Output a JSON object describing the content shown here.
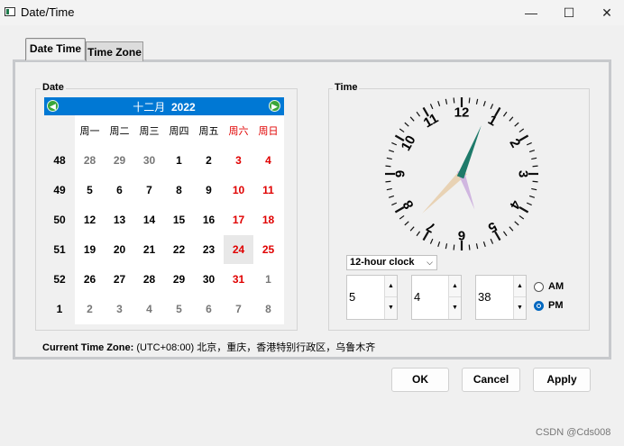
{
  "window": {
    "title": "Date/Time",
    "minimize": "—",
    "maximize": "☐",
    "close": "✕"
  },
  "tabs": [
    {
      "label": "Date Time",
      "active": true
    },
    {
      "label": "Time Zone",
      "active": false
    }
  ],
  "date_group": {
    "label": "Date"
  },
  "time_group": {
    "label": "Time"
  },
  "calendar": {
    "month": "十二月",
    "year": "2022",
    "prev_icon": "◀",
    "next_icon": "▶",
    "weekdays": [
      "周一",
      "周二",
      "周三",
      "周四",
      "周五",
      "周六",
      "周日"
    ],
    "weeks": [
      "48",
      "49",
      "50",
      "51",
      "52",
      "1"
    ],
    "rows": [
      [
        "28",
        "29",
        "30",
        "1",
        "2",
        "3",
        "4"
      ],
      [
        "5",
        "6",
        "7",
        "8",
        "9",
        "10",
        "11"
      ],
      [
        "12",
        "13",
        "14",
        "15",
        "16",
        "17",
        "18"
      ],
      [
        "19",
        "20",
        "21",
        "22",
        "23",
        "24",
        "25"
      ],
      [
        "26",
        "27",
        "28",
        "29",
        "30",
        "31",
        "1"
      ],
      [
        "2",
        "3",
        "4",
        "5",
        "6",
        "7",
        "8"
      ]
    ],
    "selected_day": "24"
  },
  "clock": {
    "numbers": [
      "12",
      "1",
      "2",
      "3",
      "4",
      "5",
      "6",
      "7",
      "8",
      "9",
      "10",
      "11"
    ],
    "hour": 5,
    "minute": 4,
    "second": 38
  },
  "time": {
    "format_label": "12-hour clock",
    "hour": "5",
    "minute": "4",
    "second": "38",
    "am_label": "AM",
    "pm_label": "PM",
    "selected": "PM"
  },
  "timezone": {
    "prefix": "Current Time Zone:",
    "value": "(UTC+08:00) 北京，重庆，香港特别行政区，乌鲁木齐"
  },
  "buttons": {
    "ok": "OK",
    "cancel": "Cancel",
    "apply": "Apply"
  },
  "watermark": "CSDN @Cds008",
  "colors": {
    "accent": "#0078d4",
    "weekend": "#e00000",
    "hour_hand": "#1e7a6a",
    "minute_hand": "#e8d2b4",
    "second_hand": "#d0b6e0"
  }
}
